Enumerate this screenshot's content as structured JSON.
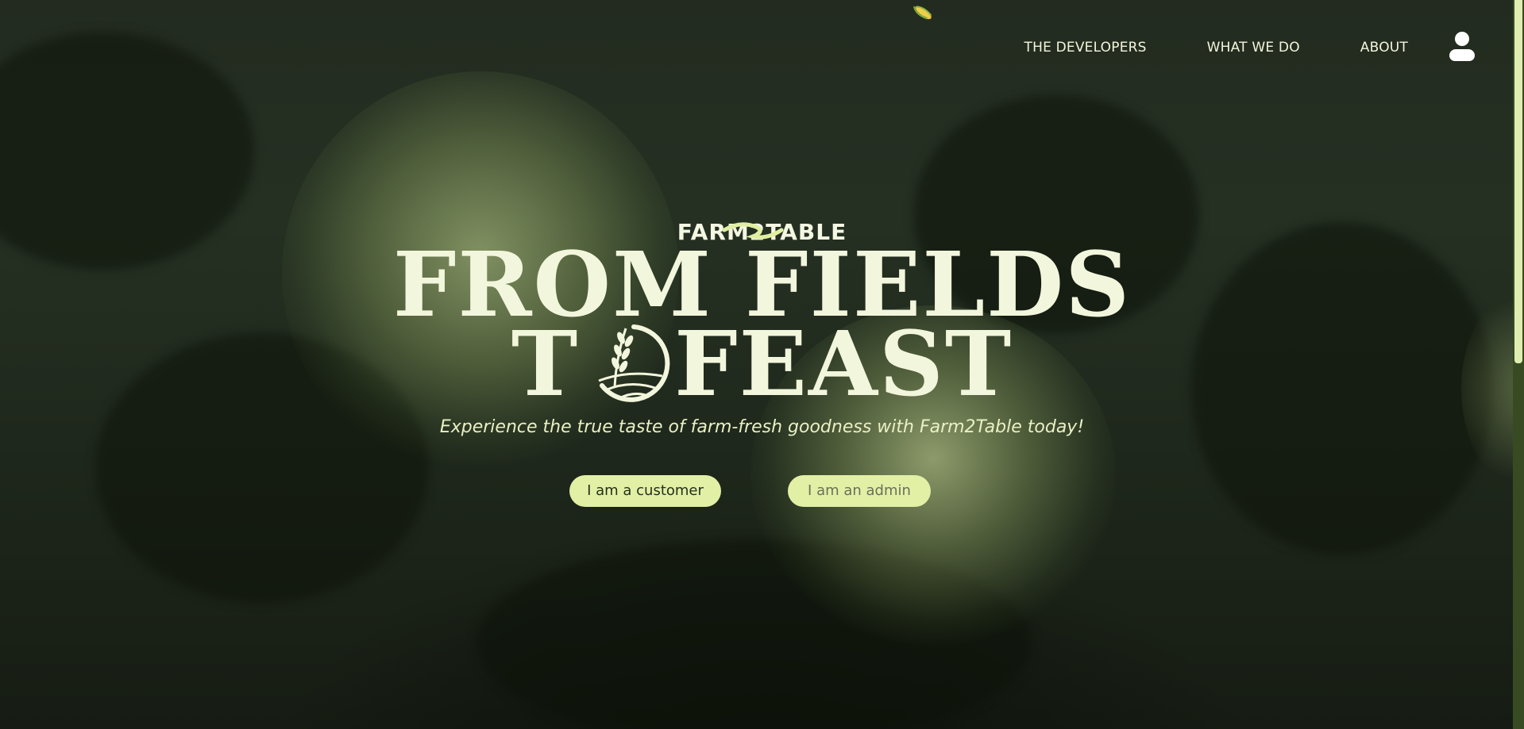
{
  "nav": {
    "items": [
      {
        "label": "THE DEVELOPERS"
      },
      {
        "label": "WHAT WE DO"
      },
      {
        "label": "ABOUT"
      }
    ],
    "profile_icon": "user-icon"
  },
  "hero": {
    "brand": "FARM2TABLE",
    "headline_line1": "FROM FIELDS",
    "headline_line2_start": "T",
    "headline_line2_end": "FEAST",
    "tagline": "Experience the true taste of farm-fresh goodness with Farm2Table today!",
    "customer_button": "I am a customer",
    "admin_button": "I am an admin"
  },
  "colors": {
    "accent": "#e2f0a6",
    "text_light": "#f2f6dc",
    "background": "#232b20"
  },
  "icons": [
    "corn-icon",
    "wheat-icon",
    "user-icon"
  ]
}
